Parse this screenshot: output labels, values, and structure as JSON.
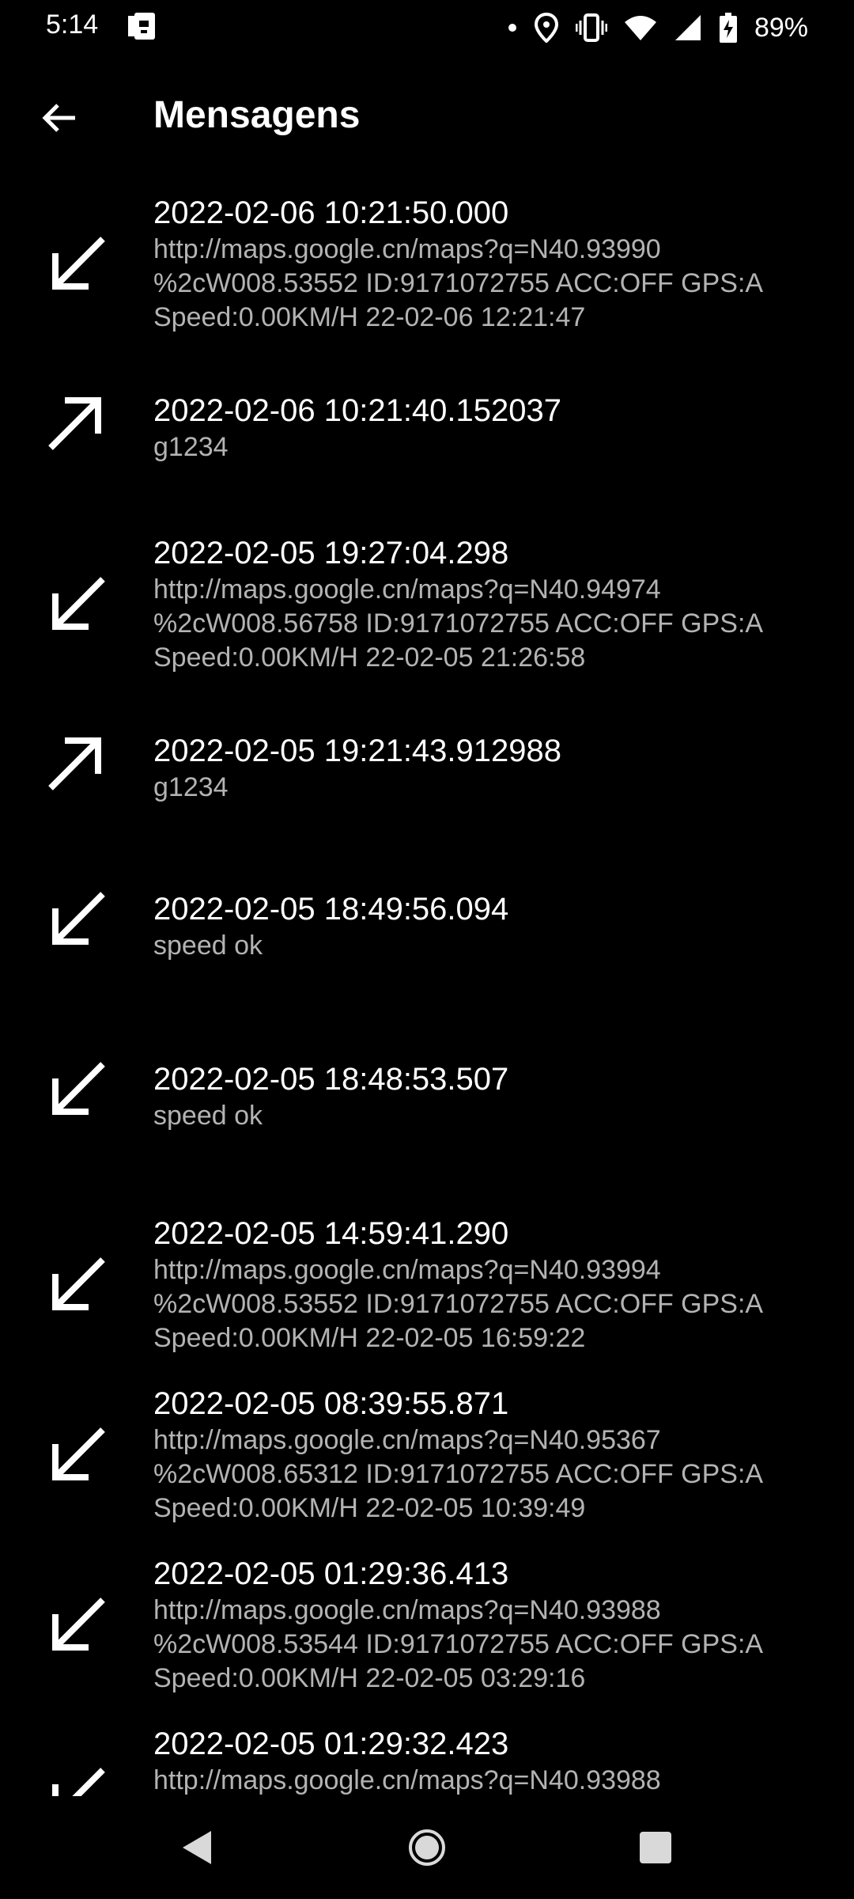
{
  "status_bar": {
    "time": "5:14",
    "battery_percent": "89%",
    "icons": [
      "sim-card-icon",
      "dot-icon",
      "location-icon",
      "vibrate-icon",
      "wifi-icon",
      "signal-icon",
      "battery-charging-icon"
    ]
  },
  "header": {
    "title": "Mensagens",
    "back_icon": "arrow-left-icon"
  },
  "messages": [
    {
      "direction": "received",
      "icon": "arrow-down-left-icon",
      "date": "2022-02-06 10:21:50.000",
      "body": "http://maps.google.cn/maps?q=N40.93990\n%2cW008.53552 ID:9171072755 ACC:OFF GPS:A\nSpeed:0.00KM/H 22-02-06 12:21:47"
    },
    {
      "direction": "sent",
      "icon": "arrow-up-right-icon",
      "date": "2022-02-06 10:21:40.152037",
      "body": "g1234"
    },
    {
      "direction": "received",
      "icon": "arrow-down-left-icon",
      "date": "2022-02-05 19:27:04.298",
      "body": "http://maps.google.cn/maps?q=N40.94974\n%2cW008.56758 ID:9171072755 ACC:OFF GPS:A\nSpeed:0.00KM/H 22-02-05 21:26:58"
    },
    {
      "direction": "sent",
      "icon": "arrow-up-right-icon",
      "date": "2022-02-05 19:21:43.912988",
      "body": "g1234"
    },
    {
      "direction": "received",
      "icon": "arrow-down-left-icon",
      "date": "2022-02-05 18:49:56.094",
      "body": "speed ok"
    },
    {
      "direction": "received",
      "icon": "arrow-down-left-icon",
      "date": "2022-02-05 18:48:53.507",
      "body": "speed ok"
    },
    {
      "direction": "received",
      "icon": "arrow-down-left-icon",
      "date": "2022-02-05 14:59:41.290",
      "body": "http://maps.google.cn/maps?q=N40.93994\n%2cW008.53552 ID:9171072755 ACC:OFF GPS:A\nSpeed:0.00KM/H 22-02-05 16:59:22"
    },
    {
      "direction": "received",
      "icon": "arrow-down-left-icon",
      "date": "2022-02-05 08:39:55.871",
      "body": "http://maps.google.cn/maps?q=N40.95367\n%2cW008.65312 ID:9171072755 ACC:OFF GPS:A\nSpeed:0.00KM/H 22-02-05 10:39:49"
    },
    {
      "direction": "received",
      "icon": "arrow-down-left-icon",
      "date": "2022-02-05 01:29:36.413",
      "body": "http://maps.google.cn/maps?q=N40.93988\n%2cW008.53544 ID:9171072755 ACC:OFF GPS:A\nSpeed:0.00KM/H 22-02-05 03:29:16"
    },
    {
      "direction": "received",
      "icon": "arrow-down-left-icon",
      "date": "2022-02-05 01:29:32.423",
      "body": "http://maps.google.cn/maps?q=N40.93988"
    }
  ],
  "nav_bar": {
    "icons": [
      "back-triangle-icon",
      "home-circle-icon",
      "recents-square-icon"
    ]
  },
  "colors": {
    "background": "#000000",
    "primary_text": "#ffffff",
    "secondary_text": "#b3b3b3"
  }
}
